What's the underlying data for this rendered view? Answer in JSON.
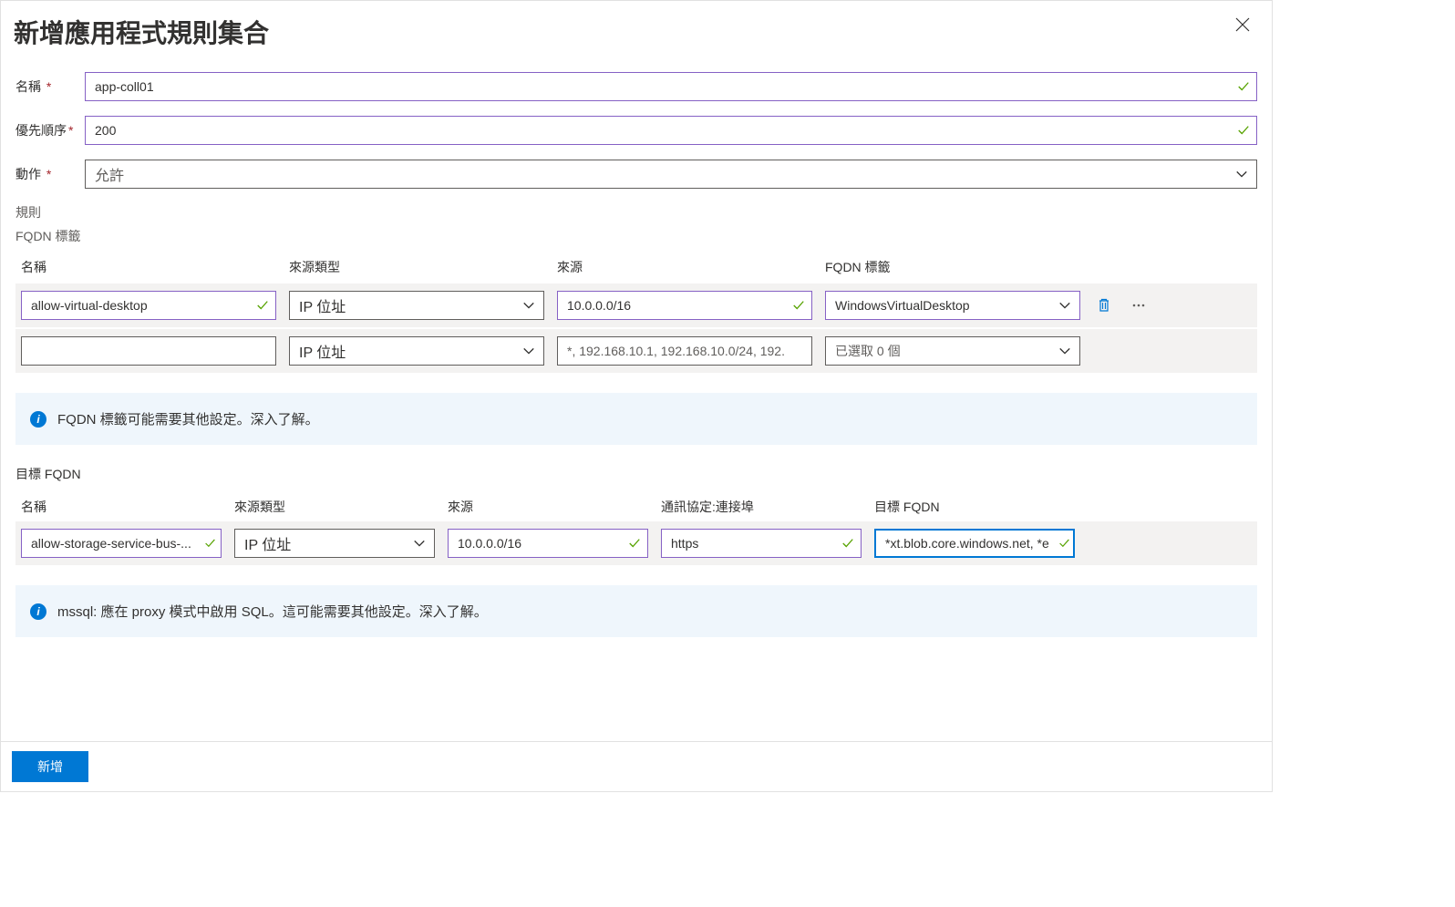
{
  "header": {
    "title": "新增應用程式規則集合"
  },
  "form": {
    "name_label": "名稱",
    "name_value": "app-coll01",
    "priority_label": "優先順序",
    "priority_value": "200",
    "action_label": "動作",
    "action_placeholder": "允許"
  },
  "sections": {
    "rules_label": "規則",
    "fqdn_tags_label": "FQDN 標籤",
    "target_fqdn_label": "目標 FQDN"
  },
  "fqdn_table": {
    "headers": {
      "name": "名稱",
      "source_type": "來源類型",
      "source": "來源",
      "fqdn_tags": "FQDN 標籤"
    },
    "rows": [
      {
        "name": "allow-virtual-desktop",
        "source_type": "IP 位址",
        "source": "10.0.0.0/16",
        "fqdn_tags": "WindowsVirtualDesktop"
      },
      {
        "name": "",
        "source_type": "IP 位址",
        "source_placeholder": "*, 192.168.10.1, 192.168.10.0/24, 192....",
        "fqdn_tags": "已選取 0 個"
      }
    ]
  },
  "info_boxes": {
    "fqdn_info": "FQDN 標籤可能需要其他設定。深入了解。",
    "mssql_info": "mssql: 應在 proxy 模式中啟用 SQL。這可能需要其他設定。深入了解。"
  },
  "target_table": {
    "headers": {
      "name": "名稱",
      "source_type": "來源類型",
      "source": "來源",
      "protocol_port": "通訊協定:連接埠",
      "target_fqdn": "目標 FQDN"
    },
    "rows": [
      {
        "name": "allow-storage-service-bus-...",
        "source_type": "IP 位址",
        "source": "10.0.0.0/16",
        "protocol": "https",
        "target_fqdn": "*xt.blob.core.windows.net, *e"
      }
    ]
  },
  "footer": {
    "add_label": "新增"
  }
}
